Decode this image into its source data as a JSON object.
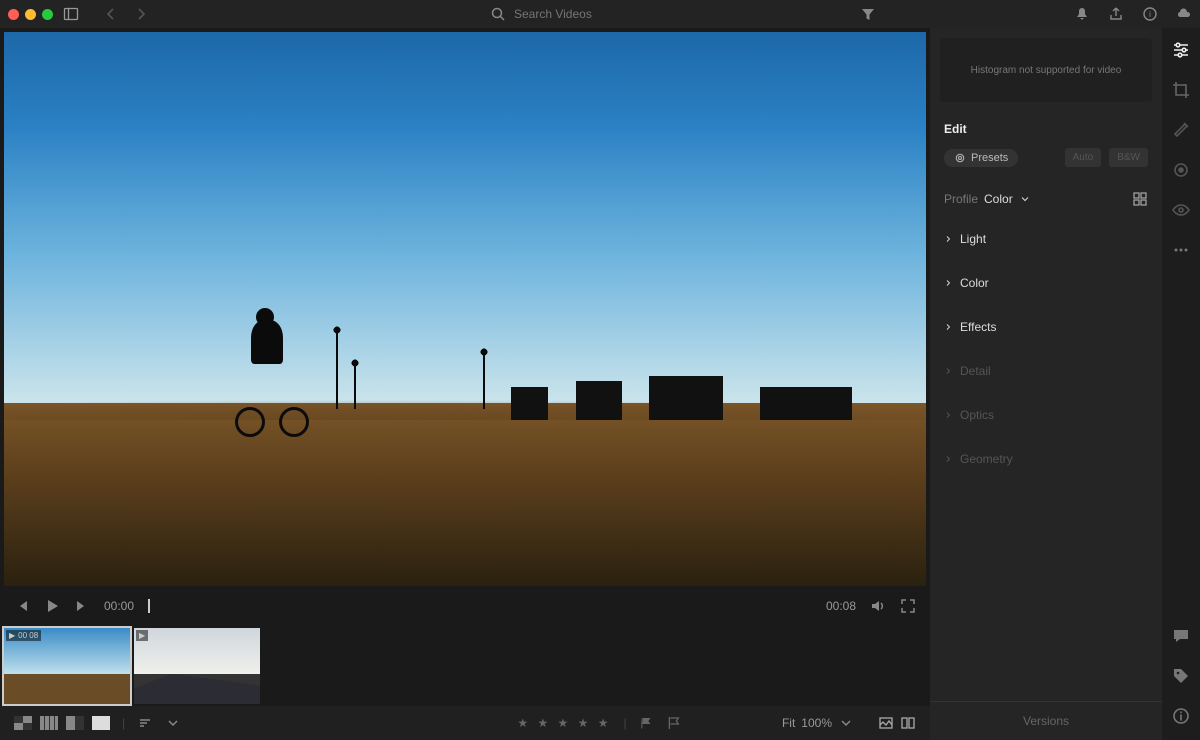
{
  "search": {
    "placeholder": "Search Videos"
  },
  "playback": {
    "current": "00:00",
    "duration": "00:08"
  },
  "filmstrip": {
    "items": [
      {
        "badge": "00 08",
        "selected": true
      },
      {
        "badge": "",
        "selected": false
      }
    ]
  },
  "bottom": {
    "fit_label": "Fit",
    "zoom": "100%"
  },
  "edit": {
    "histogram_msg": "Histogram not supported for video",
    "title": "Edit",
    "presets_label": "Presets",
    "btn_auto": "Auto",
    "btn_bw": "B&W",
    "profile_label": "Profile",
    "profile_value": "Color",
    "sections": [
      {
        "label": "Light",
        "enabled": true
      },
      {
        "label": "Color",
        "enabled": true
      },
      {
        "label": "Effects",
        "enabled": true
      },
      {
        "label": "Detail",
        "enabled": false
      },
      {
        "label": "Optics",
        "enabled": false
      },
      {
        "label": "Geometry",
        "enabled": false
      }
    ],
    "versions_label": "Versions"
  }
}
